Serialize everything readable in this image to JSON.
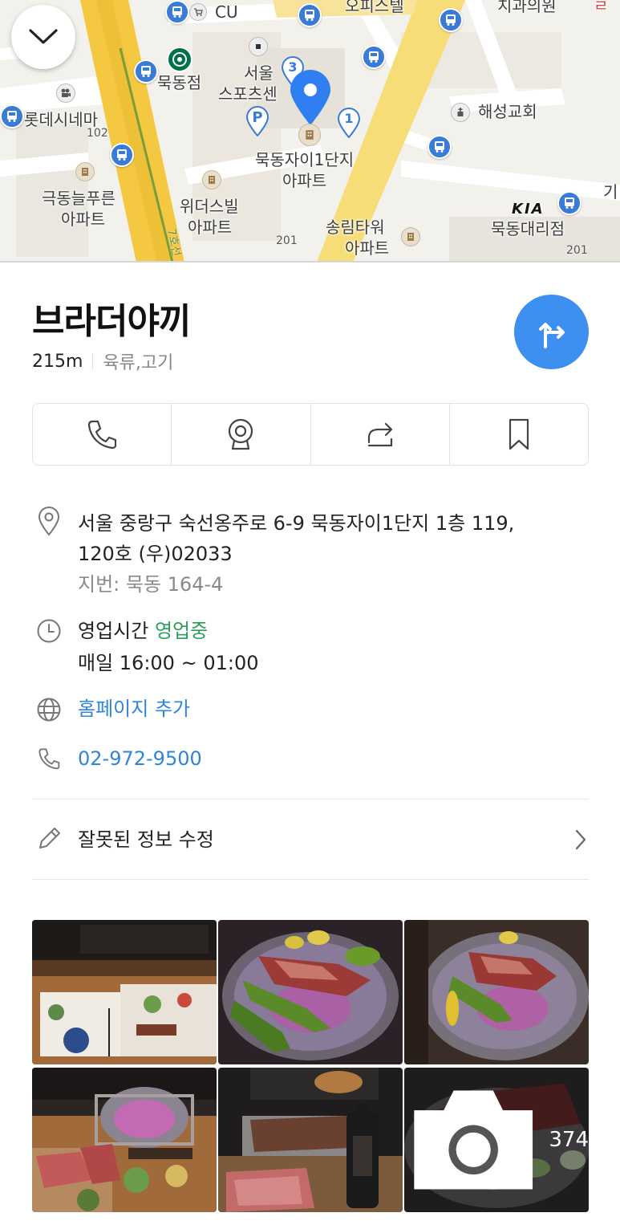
{
  "map": {
    "labels": {
      "officetel": "오피스텔",
      "clinic": "치과의원",
      "cu": "CU",
      "mukdong_store": "묵동점",
      "seoul_sports_1": "서울",
      "seoul_sports_2": "스포츠센",
      "lotte_cinema": "롯데시네마",
      "haesung_church": "해성교회",
      "xi_apt_1": "묵동자이1단지",
      "xi_apt_2": "아파트",
      "geukdong_1": "극동늘푸른",
      "geukdong_2": "아파트",
      "wonders_1": "위더스빌",
      "wonders_2": "아파트",
      "songrim_1": "송림타워",
      "songrim_2": "아파트",
      "kia_dealer": "묵동대리점",
      "kia_logo": "KIA",
      "road_number_102": "102",
      "road_number_201_a": "201",
      "road_number_201_b": "201",
      "road_line": "7호선",
      "edge_char": "기",
      "parking": "P",
      "cluster_3": "3",
      "cluster_1": "1"
    }
  },
  "place": {
    "name": "브라더야끼",
    "distance": "215m",
    "category": "육류,고기",
    "address_line1": "서울 중랑구 숙선옹주로 6-9 묵동자이1단지 1층 119,",
    "address_line2": "120호 (우)02033",
    "lot_address": "지번: 묵동 164-4",
    "hours_label": "영업시간",
    "hours_status": "영업중",
    "hours_detail": "매일 16:00 ~ 01:00",
    "homepage": "홈페이지 추가",
    "phone": "02-972-9500",
    "edit_label": "잘못된 정보 수정"
  },
  "photos": {
    "count": "374"
  },
  "colors": {
    "accent": "#3d8ff0",
    "open_green": "#2d9e5a",
    "link_blue": "#2f86d6",
    "bus_blue": "#3a7bd5",
    "arterial_yellow": "#f5c842"
  },
  "icons": [
    "chevron-down-icon",
    "directions-icon",
    "phone-icon",
    "cctv-icon",
    "share-icon",
    "bookmark-icon",
    "location-pin-icon",
    "clock-icon",
    "globe-icon",
    "pencil-icon",
    "chevron-right-icon",
    "camera-icon",
    "bus-icon"
  ]
}
